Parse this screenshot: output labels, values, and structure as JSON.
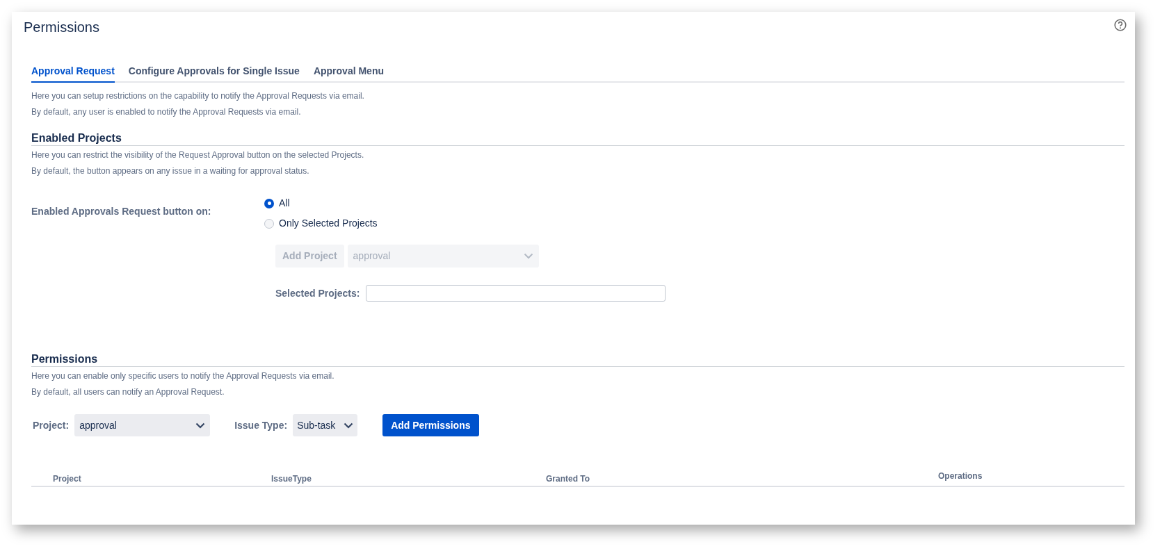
{
  "title": "Permissions",
  "tabs": [
    {
      "label": "Approval Request",
      "selected": true
    },
    {
      "label": "Configure Approvals for Single Issue",
      "selected": false
    },
    {
      "label": "Approval Menu",
      "selected": false
    }
  ],
  "intro": [
    "Here you can setup restrictions on the capability to notify the Approval Requests via email.",
    "By default, any user is enabled to notify the Approval Requests via email."
  ],
  "enabled_projects": {
    "heading": "Enabled Projects",
    "description": [
      "Here you can restrict the visibility of the Request Approval button on the selected Projects.",
      "By default, the button appears on any issue in a waiting for approval status."
    ],
    "label": "Enabled Approvals Request button on:",
    "options": [
      {
        "label": "All",
        "selected": true
      },
      {
        "label": "Only Selected Projects",
        "selected": false
      }
    ],
    "add_project_button": {
      "label": "Add Project",
      "disabled": true
    },
    "project_select": {
      "value": "approval",
      "disabled": true
    },
    "selected_projects_label": "Selected Projects:"
  },
  "permissions": {
    "heading": "Permissions",
    "description": [
      "Here you can enable only specific users to notify the Approval Requests via email.",
      "By default, all users can notify an Approval Request."
    ],
    "project_label": "Project:",
    "project_value": "approval",
    "issue_type_label": "Issue Type:",
    "issue_type_value": "Sub-task",
    "add_button": "Add Permissions",
    "table": {
      "columns": [
        "Project",
        "IssueType",
        "Granted To",
        "Operations"
      ]
    }
  }
}
